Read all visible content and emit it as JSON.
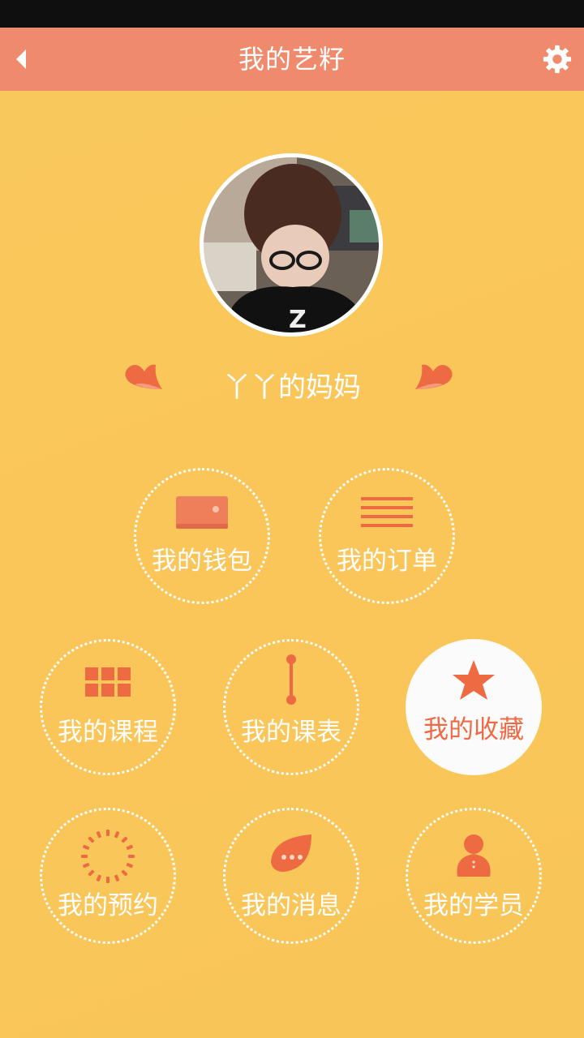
{
  "header": {
    "title": "我的艺籽"
  },
  "profile": {
    "username": "丫丫的妈妈"
  },
  "menu": {
    "wallet": "我的钱包",
    "orders": "我的订单",
    "courses": "我的课程",
    "schedule": "我的课表",
    "favorites": "我的收藏",
    "appointments": "我的预约",
    "messages": "我的消息",
    "students": "我的学员"
  },
  "colors": {
    "background": "#f9c85c",
    "header": "#ef8a6c",
    "accent": "#ef6a44"
  },
  "icons": {
    "back": "back-arrow-icon",
    "settings": "gear-icon",
    "wallet": "wallet-icon",
    "orders": "list-icon",
    "courses": "grid-icon",
    "schedule": "timeline-icon",
    "favorites": "star-icon",
    "appointments": "sunburst-icon",
    "messages": "chat-bubble-icon",
    "students": "student-icon"
  }
}
